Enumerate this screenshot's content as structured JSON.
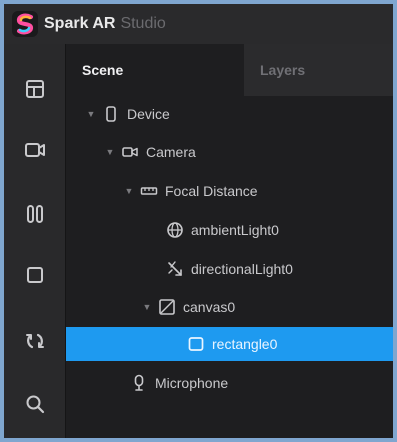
{
  "app": {
    "name": "Spark AR",
    "name_sub": "Studio"
  },
  "colors": {
    "accent": "#1e9af0",
    "frame_border": "#7fa6cf"
  },
  "toolbar": {
    "items": [
      {
        "icon": "layout-icon"
      },
      {
        "icon": "video-camera-icon"
      },
      {
        "icon": "pause-columns-icon"
      },
      {
        "icon": "square-icon"
      },
      {
        "icon": "refresh-icon"
      },
      {
        "icon": "search-icon"
      }
    ]
  },
  "panel": {
    "tabs": [
      {
        "label": "Scene",
        "active": true
      },
      {
        "label": "Layers",
        "active": false
      }
    ],
    "tree": [
      {
        "label": "Device",
        "icon": "device-icon",
        "expanded": true
      },
      {
        "label": "Camera",
        "icon": "camera-icon",
        "expanded": true
      },
      {
        "label": "Focal Distance",
        "icon": "focal-distance-icon",
        "expanded": true
      },
      {
        "label": "ambientLight0",
        "icon": "ambient-light-icon"
      },
      {
        "label": "directionalLight0",
        "icon": "directional-light-icon"
      },
      {
        "label": "canvas0",
        "icon": "canvas-icon",
        "expanded": true
      },
      {
        "label": "rectangle0",
        "icon": "rectangle-icon",
        "selected": true
      },
      {
        "label": "Microphone",
        "icon": "microphone-icon"
      }
    ]
  }
}
